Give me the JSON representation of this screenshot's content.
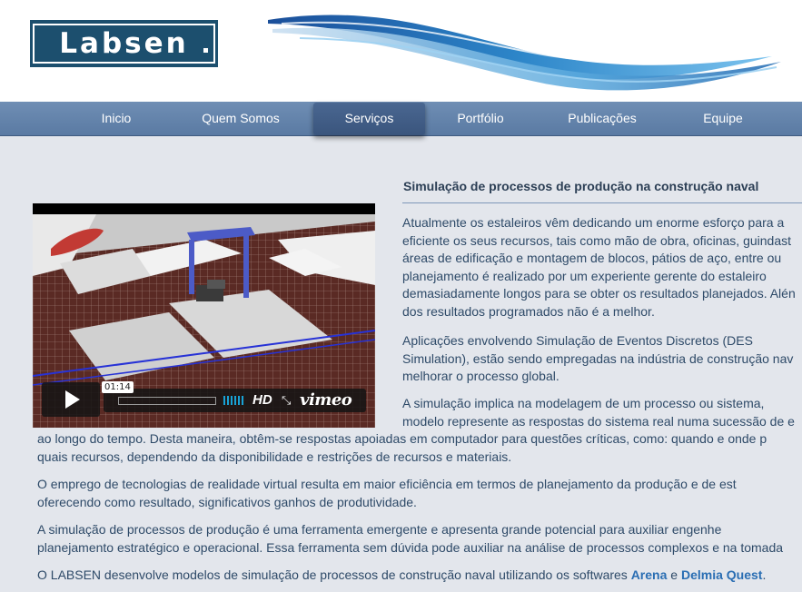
{
  "brand": {
    "logo_text": "Labsen"
  },
  "nav": {
    "items": [
      {
        "label": "Inicio"
      },
      {
        "label": "Quem Somos"
      },
      {
        "label": "Serviços"
      },
      {
        "label": "Portfólio"
      },
      {
        "label": "Publicações"
      },
      {
        "label": "Equipe"
      }
    ],
    "active": "Serviços"
  },
  "article": {
    "title": "Simulação de processos de produção na construção naval",
    "p1": [
      "Atualmente os estaleiros vêm dedicando um enorme esforço para a",
      "eficiente os seus recursos, tais como mão de obra, oficinas, guindast",
      "áreas de edificação e montagem de blocos, pátios de aço, entre ou",
      "planejamento é realizado por um experiente gerente do estaleiro",
      "demasiadamente longos para se obter os resultados planejados. Alén",
      "dos resultados programados não é a melhor."
    ],
    "p2": [
      "Aplicações envolvendo Simulação de Eventos Discretos (DES",
      "Simulation), estão sendo empregadas na indústria de construção nav",
      "melhorar o processo global."
    ],
    "p3_right": [
      "A simulação implica na modelagem de um processo ou sistema,",
      "modelo represente as respostas do sistema real numa sucessão de e"
    ],
    "p3_full": [
      "ao longo do tempo. Desta maneira, obtêm-se respostas apoiadas em computador para questões críticas, como: quando e onde p",
      "quais recursos, dependendo da disponibilidade e restrições de recursos e materiais."
    ],
    "p4": [
      "O emprego de tecnologias de realidade virtual resulta em maior eficiência em termos de planejamento da produção e de est",
      "oferecendo como resultado, significativos ganhos de produtividade."
    ],
    "p5": [
      "A simulação de processos de produção é uma ferramenta emergente e apresenta grande potencial para auxiliar engenhe",
      "planejamento estratégico e operacional. Essa ferramenta sem dúvida pode auxiliar na análise de processos complexos e na tomada"
    ],
    "p6": {
      "before": "O LABSEN desenvolve modelos de simulação de processos de construção naval utilizando os softwares ",
      "link1": "Arena",
      "and": " e ",
      "link2": "Delmia Quest",
      "after": "."
    }
  },
  "video": {
    "timecode": "01:14",
    "hd_label": "HD",
    "provider": "vimeo",
    "icons": [
      "play-icon",
      "volume-icon",
      "fullscreen-icon"
    ]
  }
}
